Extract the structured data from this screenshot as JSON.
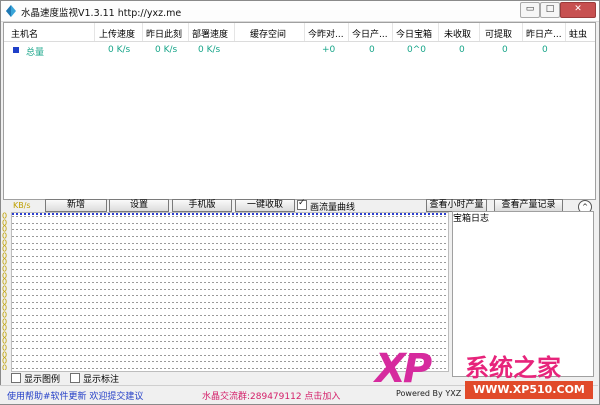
{
  "window": {
    "title": "水晶速度监视V1.3.11 http://yxz.me",
    "minimize_glyph": "▭",
    "maximize_glyph": "□",
    "close_glyph": "✕"
  },
  "table": {
    "columns": [
      "主机名",
      "上传速度",
      "昨日此刻",
      "部署速度",
      "缓存空间",
      "今昨对...",
      "今日产...",
      "今日宝箱",
      "未收取",
      "可提取",
      "昨日产...",
      "蛀虫"
    ],
    "rows": [
      {
        "name": "总量",
        "upload": "0 K/s",
        "yesterday_now": "0 K/s",
        "deploy": "0 K/s",
        "cache": "",
        "vs_yesterday": "+0",
        "today_output": "0",
        "today_box": "0^0",
        "uncollected": "0",
        "withdrawable": "0",
        "yesterday_output": "0",
        "worm": ""
      }
    ]
  },
  "toolbar": {
    "unit": "KB/s",
    "add": "新增",
    "settings": "设置",
    "mobile": "手机版",
    "collect_all": "一键收取",
    "draw_traffic": "画流量曲线",
    "draw_traffic_checked": true,
    "hourly": "查看小时产量",
    "records": "查看产量记录",
    "collapse_glyph": "^"
  },
  "chart_data": {
    "type": "line",
    "ylabel": "KB/s",
    "y_tick_labels": [
      "0",
      "0",
      "0",
      "0",
      "0",
      "0",
      "0",
      "0",
      "0",
      "0",
      "0",
      "0",
      "0",
      "0",
      "0",
      "0",
      "0",
      "0",
      "0",
      "0",
      "0",
      "0",
      "0",
      "0"
    ],
    "series": [
      {
        "values": []
      }
    ]
  },
  "log_panel": {
    "title": "宝箱日志"
  },
  "legend_toggles": {
    "show_legend": "显示图例",
    "show_labels": "显示标注"
  },
  "status": {
    "help": "使用帮助#软件更新 欢迎提交建议",
    "group": "水晶交流群:289479112 点击加入",
    "powered": "Powered By YXZ"
  },
  "watermark": {
    "xp": "XP",
    "cn": "系统之家",
    "url": "WWW.XP510.COM"
  },
  "colors": {
    "accent": "#17a589",
    "marker": "#1f3fc8",
    "axis_labels": "#bfa000",
    "help_link": "#2540c8",
    "group_link": "#d4206a"
  }
}
